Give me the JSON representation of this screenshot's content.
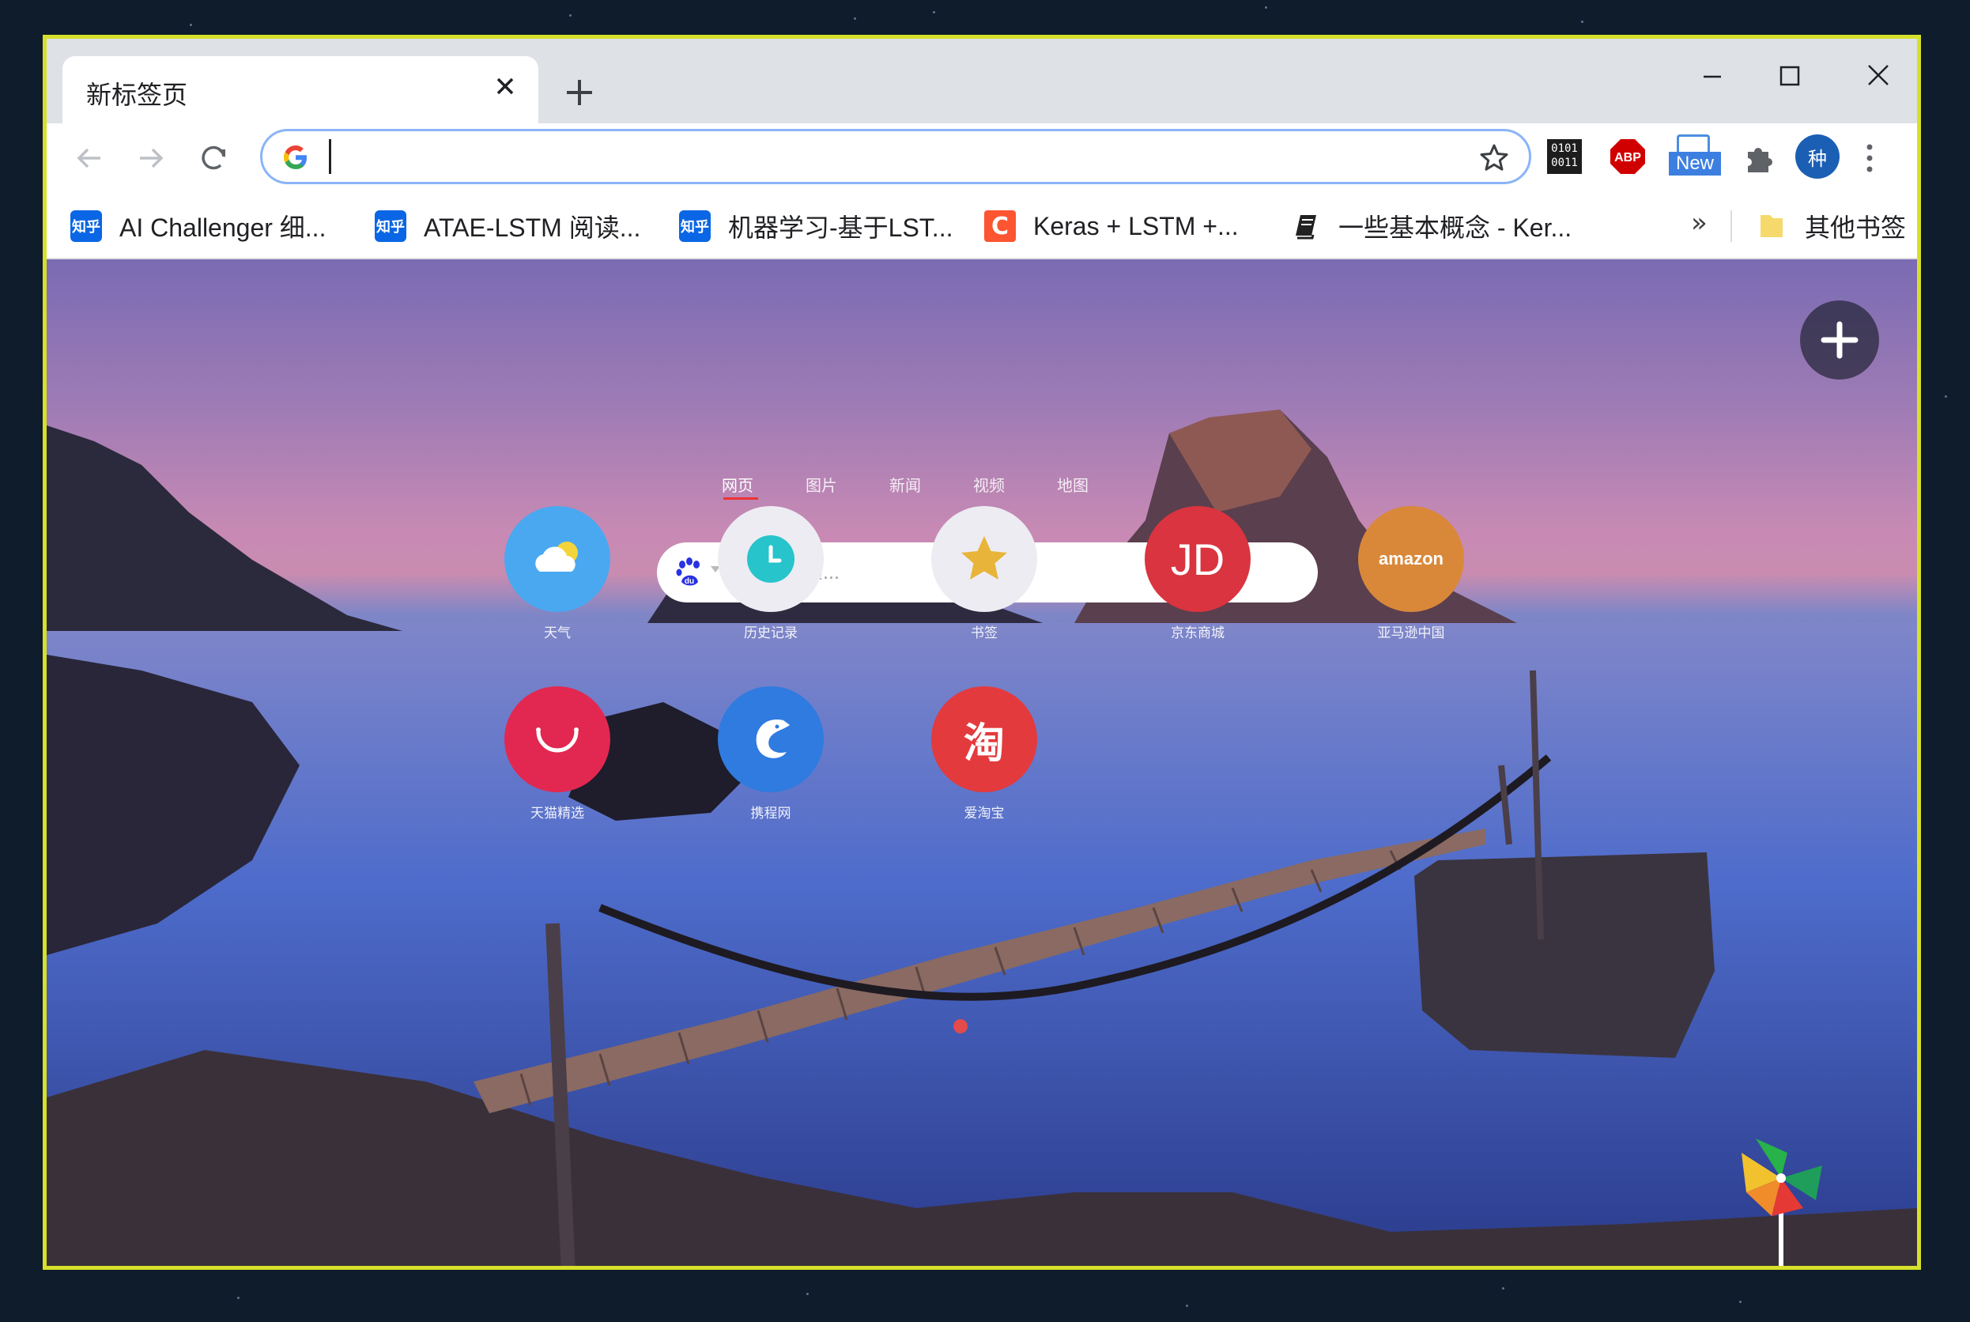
{
  "tab": {
    "title": "新标签页"
  },
  "omnibox": {
    "value": "",
    "placeholder": ""
  },
  "toolbar": {
    "extensions": [
      {
        "name": "binary-extension",
        "label_top": "0101",
        "label_bottom": "0011"
      },
      {
        "name": "adblock-plus",
        "label": "ABP"
      },
      {
        "name": "new-extension",
        "label": "New"
      },
      {
        "name": "extensions-puzzle"
      },
      {
        "name": "profile",
        "label": "种"
      }
    ]
  },
  "bookmarks": {
    "items": [
      {
        "icon": "知乎",
        "label": "AI Challenger 细..."
      },
      {
        "icon": "知乎",
        "label": "ATAE-LSTM 阅读..."
      },
      {
        "icon": "知乎",
        "label": "机器学习-基于LST..."
      },
      {
        "icon": "C",
        "label": "Keras + LSTM +..."
      },
      {
        "icon": "book",
        "label": "一些基本概念 - Ker..."
      }
    ],
    "overflow": "»",
    "other": "其他书签"
  },
  "ntp": {
    "search_tabs": [
      "网页",
      "图片",
      "新闻",
      "视频",
      "地图"
    ],
    "search_placeholder": "输入并搜索...",
    "baidu_badge": "du",
    "sites": [
      {
        "label": "天气",
        "color": "#4aa8f0"
      },
      {
        "label": "历史记录",
        "color": "#ececf2"
      },
      {
        "label": "书签",
        "color": "#ececf2"
      },
      {
        "label": "京东商城",
        "color": "#d9343f",
        "mark": "JD"
      },
      {
        "label": "亚马逊中国",
        "color": "#d9883a",
        "mark": "amazon"
      },
      {
        "label": "天猫精选",
        "color": "#e22850"
      },
      {
        "label": "携程网",
        "color": "#2f7be0"
      },
      {
        "label": "爱淘宝",
        "color": "#e33a3e",
        "mark": "淘"
      }
    ]
  }
}
